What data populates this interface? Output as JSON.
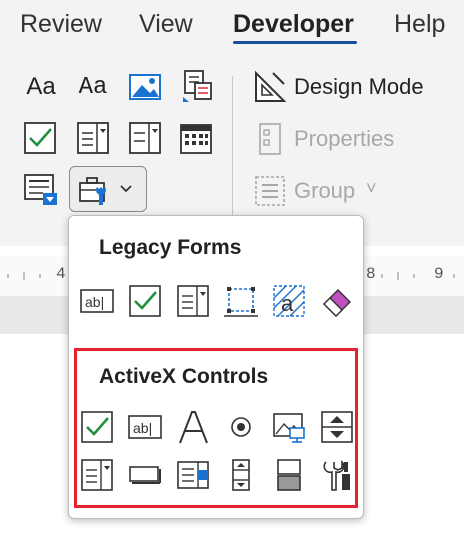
{
  "tabs": [
    {
      "label": "Review"
    },
    {
      "label": "View"
    },
    {
      "label": "Developer",
      "active": true
    },
    {
      "label": "Help"
    }
  ],
  "ribbon": {
    "design_mode": "Design Mode",
    "properties": "Properties",
    "group": "Group",
    "group_chevron": "˅",
    "text_control_glyph_1": "Aa",
    "text_control_glyph_2": "Aa"
  },
  "ruler": {
    "left_number": "4",
    "right_numbers": [
      "8",
      "9"
    ]
  },
  "panel": {
    "legacy_title": "Legacy Forms",
    "legacy_items": [
      "text-form-field",
      "check-box-form-field",
      "combo-box-form-field",
      "frame",
      "shading",
      "reset-form-fields"
    ],
    "activex_title": "ActiveX Controls",
    "activex_row1": [
      "check-box",
      "text-box",
      "label",
      "option-button",
      "image",
      "spin-button"
    ],
    "activex_row2": [
      "combo-box",
      "command-button",
      "list-box",
      "scroll-bar",
      "toggle-button",
      "more-controls"
    ]
  },
  "colors": {
    "accent": "#1a4f9c",
    "highlight": "#e3232d",
    "check": "#1f8f3d",
    "blue": "#1a73d0",
    "pink": "#c04fc0"
  }
}
